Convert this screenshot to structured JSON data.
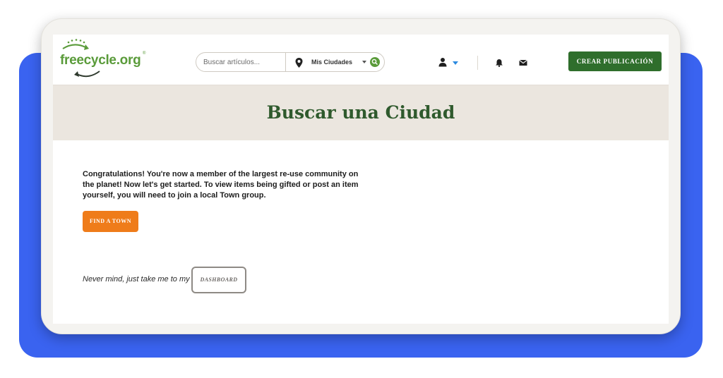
{
  "header": {
    "logo_text": "freecycle.org",
    "logo_mark": "®",
    "search": {
      "placeholder": "Buscar artículos...",
      "city_label": "Mis Ciudades"
    },
    "create_label": "CREAR PUBLICACIÓN"
  },
  "page": {
    "title": "Buscar una Ciudad"
  },
  "card": {
    "message": "Congratulations! You're now a member of the largest re-use community on the planet! Now let's get started. To view items being gifted or post an item yourself, you will need to join a local Town group.",
    "find_label": "FIND A TOWN",
    "nevermind_text": "Never mind, just take me to my",
    "dashboard_label": "DASHBOARD"
  },
  "colors": {
    "brand_green": "#5a9b3a",
    "button_green": "#2f6e2c",
    "accent_orange": "#ef7c1a",
    "backdrop_blue": "#3a63f0"
  },
  "icons": [
    "recycle-arrows-icon",
    "map-pin-icon",
    "search-icon",
    "user-icon",
    "chevron-down-icon",
    "bell-icon",
    "mail-icon"
  ]
}
